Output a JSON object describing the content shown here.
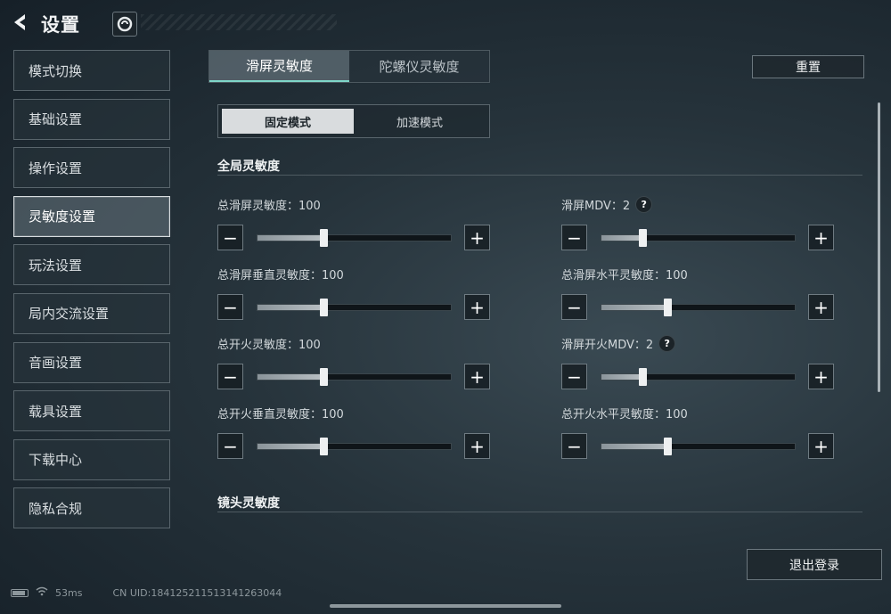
{
  "header": {
    "title": "设置",
    "back_icon": "back-arrow-icon",
    "logo_icon": "game-logo-icon"
  },
  "sidebar": {
    "items": [
      {
        "label": "模式切换",
        "active": false
      },
      {
        "label": "基础设置",
        "active": false
      },
      {
        "label": "操作设置",
        "active": false
      },
      {
        "label": "灵敏度设置",
        "active": true
      },
      {
        "label": "玩法设置",
        "active": false
      },
      {
        "label": "局内交流设置",
        "active": false
      },
      {
        "label": "音画设置",
        "active": false
      },
      {
        "label": "载具设置",
        "active": false
      },
      {
        "label": "下载中心",
        "active": false
      },
      {
        "label": "隐私合规",
        "active": false
      }
    ]
  },
  "tabs": [
    {
      "label": "滑屏灵敏度",
      "active": true
    },
    {
      "label": "陀螺仪灵敏度",
      "active": false
    }
  ],
  "reset_label": "重置",
  "mode": [
    {
      "label": "固定模式",
      "active": true
    },
    {
      "label": "加速模式",
      "active": false
    }
  ],
  "sections": {
    "global": "全局灵敏度",
    "scope": "镜头灵敏度"
  },
  "sliders": [
    {
      "label": "总滑屏灵敏度：100",
      "fraction": 0.34,
      "help": false
    },
    {
      "label": "滑屏MDV：2",
      "fraction": 0.21,
      "help": true
    },
    {
      "label": "总滑屏垂直灵敏度：100",
      "fraction": 0.34,
      "help": false
    },
    {
      "label": "总滑屏水平灵敏度：100",
      "fraction": 0.34,
      "help": false
    },
    {
      "label": "总开火灵敏度：100",
      "fraction": 0.34,
      "help": false
    },
    {
      "label": "滑屏开火MDV：2",
      "fraction": 0.21,
      "help": true
    },
    {
      "label": "总开火垂直灵敏度：100",
      "fraction": 0.34,
      "help": false
    },
    {
      "label": "总开火水平灵敏度：100",
      "fraction": 0.34,
      "help": false
    }
  ],
  "stepper": {
    "minus": "−",
    "plus": "+",
    "help": "?"
  },
  "logout_label": "退出登录",
  "footer": {
    "ping": "53ms",
    "uid": "CN UID:184125211513141263044"
  },
  "colors": {
    "accent": "#7fd6c9",
    "active_bg": "#d9dcde"
  }
}
